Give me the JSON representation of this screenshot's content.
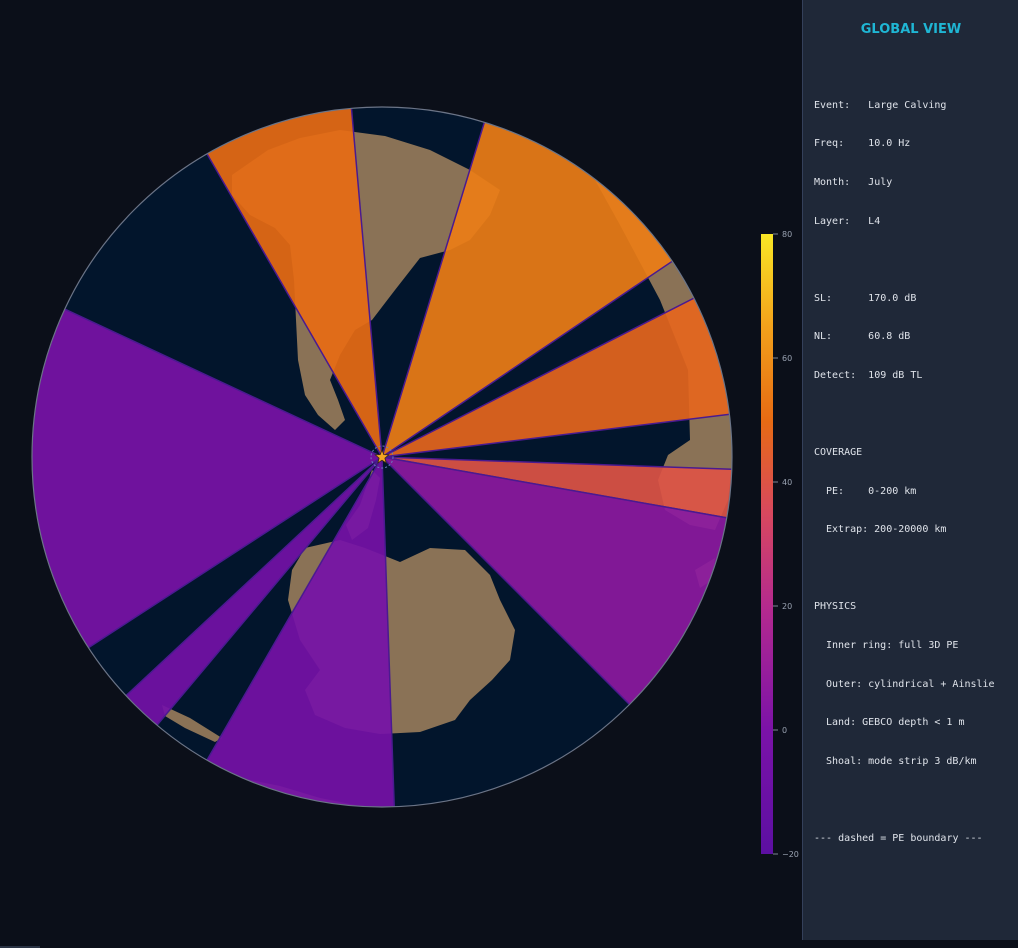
{
  "panel": {
    "title": "GLOBAL VIEW",
    "event": "Event:   Large Calving",
    "freq": "Freq:    10.0 Hz",
    "month": "Month:   July",
    "layer": "Layer:   L4",
    "sl": "SL:      170.0 dB",
    "nl": "NL:      60.8 dB",
    "detect": "Detect:  109 dB TL",
    "coverage_header": "COVERAGE",
    "coverage_pe": "PE:    0-200 km",
    "coverage_extrap": "Extrap: 200-20000 km",
    "physics_header": "PHYSICS",
    "physics_inner": "Inner ring: full 3D PE",
    "physics_outer": "Outer: cylindrical + Ainslie",
    "physics_land": "Land: GEBCO depth < 1 m",
    "physics_shoal": "Shoal: mode strip 3 dB/km",
    "legend_note": "--- dashed = PE boundary ---"
  },
  "colors": {
    "background": "#0b0f19",
    "ocean": "#02152c",
    "land": "#8a7256",
    "panel": "#1f2838",
    "title": "#1fb6d4",
    "source_marker": "#f5a623"
  },
  "chart_data": {
    "type": "heatmap",
    "projection": "azimuthal",
    "colormap": "plasma",
    "colorbar": {
      "min": -20,
      "max": 80,
      "ticks": [
        80,
        60,
        40,
        20,
        0,
        -20
      ]
    },
    "source": {
      "marker": "star"
    },
    "sectors": [
      {
        "bearing_start": 17,
        "bearing_end": 56,
        "level": 55
      },
      {
        "bearing_start": 63,
        "bearing_end": 83,
        "level": 48
      },
      {
        "bearing_start": 92,
        "bearing_end": 100,
        "level": 40
      },
      {
        "bearing_start": 100,
        "bearing_end": 135,
        "level": 6
      },
      {
        "bearing_start": 178,
        "bearing_end": 210,
        "level": -4
      },
      {
        "bearing_start": 220,
        "bearing_end": 227,
        "level": -5
      },
      {
        "bearing_start": 237,
        "bearing_end": 295,
        "level": -2
      },
      {
        "bearing_start": 330,
        "bearing_end": 355,
        "level": 50
      }
    ]
  }
}
